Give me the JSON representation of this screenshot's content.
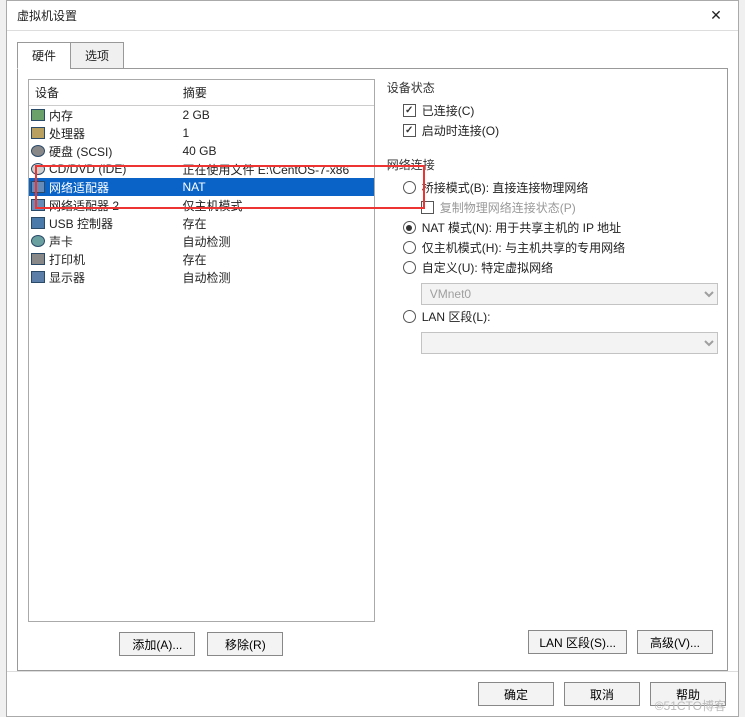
{
  "title": "虚拟机设置",
  "tabs": {
    "hardware": "硬件",
    "options": "选项",
    "active": "hardware"
  },
  "headers": {
    "device": "设备",
    "summary": "摘要"
  },
  "devices": [
    {
      "name": "内存",
      "summary": "2 GB",
      "icon": "mem"
    },
    {
      "name": "处理器",
      "summary": "1",
      "icon": "cpu"
    },
    {
      "name": "硬盘 (SCSI)",
      "summary": "40 GB",
      "icon": "disk"
    },
    {
      "name": "CD/DVD (IDE)",
      "summary": "正在使用文件 E:\\CentOS-7-x86",
      "icon": "cd"
    },
    {
      "name": "网络适配器",
      "summary": "NAT",
      "icon": "net",
      "selected": true
    },
    {
      "name": "网络适配器 2",
      "summary": "仅主机模式",
      "icon": "net"
    },
    {
      "name": "USB 控制器",
      "summary": "存在",
      "icon": "usb"
    },
    {
      "name": "声卡",
      "summary": "自动检测",
      "icon": "sound"
    },
    {
      "name": "打印机",
      "summary": "存在",
      "icon": "printer"
    },
    {
      "name": "显示器",
      "summary": "自动检测",
      "icon": "display"
    }
  ],
  "left_buttons": {
    "add": "添加(A)...",
    "remove": "移除(R)"
  },
  "right_panel": {
    "device_status": {
      "title": "设备状态",
      "connected": "已连接(C)",
      "connect_at_power": "启动时连接(O)"
    },
    "network": {
      "title": "网络连接",
      "bridged": "桥接模式(B): 直接连接物理网络",
      "replicate": "复制物理网络连接状态(P)",
      "nat": "NAT 模式(N): 用于共享主机的 IP 地址",
      "hostonly": "仅主机模式(H): 与主机共享的专用网络",
      "custom": "自定义(U): 特定虚拟网络",
      "custom_value": "VMnet0",
      "lan": "LAN 区段(L):",
      "lan_value": ""
    },
    "buttons": {
      "lan_seg": "LAN 区段(S)...",
      "advanced": "高级(V)..."
    }
  },
  "bottom": {
    "ok": "确定",
    "cancel": "取消",
    "help": "帮助"
  },
  "watermark": "©51CTO博客"
}
